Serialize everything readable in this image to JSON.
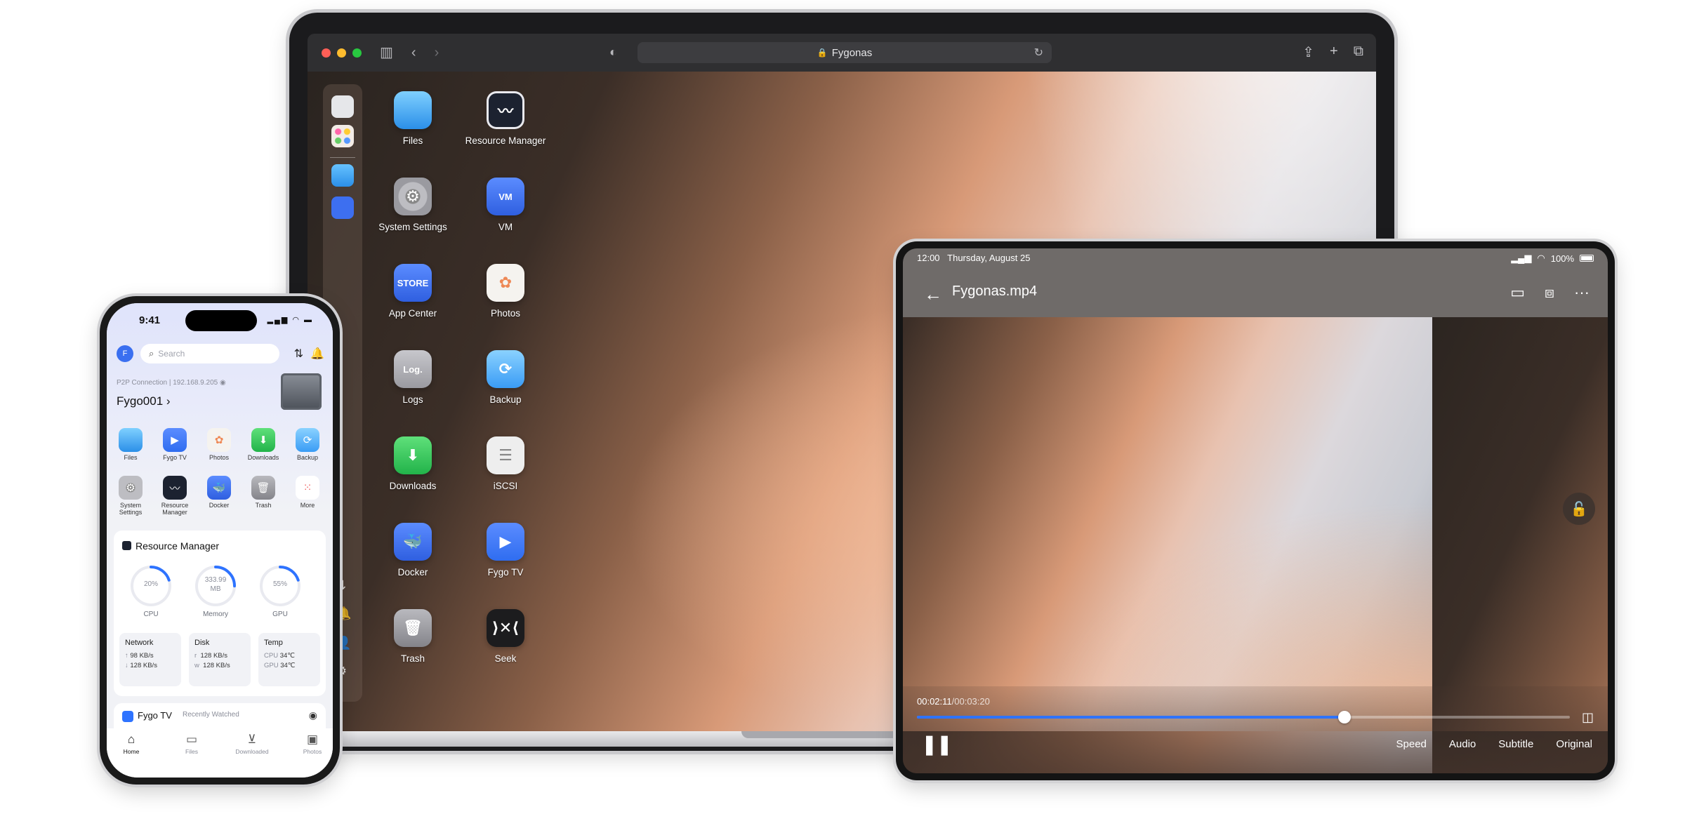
{
  "colors": {
    "accent": "#2e73ff",
    "files_blue": "#3aa7f3",
    "green": "#34c759",
    "docker_blue": "#3d6ff0"
  },
  "laptop": {
    "browser": {
      "address": "Fygonas"
    },
    "apps": [
      {
        "label": "Files",
        "icon": "folder-icon"
      },
      {
        "label": "Resource Manager",
        "icon": "pulse-icon"
      },
      {
        "label": "System Settings",
        "icon": "gear-icon"
      },
      {
        "label": "VM",
        "icon": "vm-icon",
        "badge": "VM"
      },
      {
        "label": "App Center",
        "icon": "store-icon",
        "badge": "STORE"
      },
      {
        "label": "Photos",
        "icon": "flower-icon"
      },
      {
        "label": "Logs",
        "icon": "logs-icon",
        "badge": "Log."
      },
      {
        "label": "Backup",
        "icon": "sync-icon"
      },
      {
        "label": "Downloads",
        "icon": "download-icon"
      },
      {
        "label": "iSCSI",
        "icon": "disk-icon"
      },
      {
        "label": "Docker",
        "icon": "whale-icon"
      },
      {
        "label": "Fygo TV",
        "icon": "tv-icon"
      },
      {
        "label": "Trash",
        "icon": "trash-icon"
      },
      {
        "label": "Seek",
        "icon": "seek-icon"
      }
    ]
  },
  "tablet": {
    "status": {
      "time": "12:00",
      "date": "Thursday, August 25",
      "battery": "100%"
    },
    "title": "Fygonas.mp4",
    "player": {
      "current": "00:02:11",
      "total": "/00:03:20",
      "progress": 0.655,
      "options": [
        "Speed",
        "Audio",
        "Subtitle",
        "Original"
      ]
    }
  },
  "phone": {
    "status": {
      "time": "9:41"
    },
    "avatar": "F",
    "search_placeholder": "Search",
    "connection": "P2P Connection | 192.168.9.205",
    "device": "Fygo001",
    "apps": [
      {
        "label": "Files"
      },
      {
        "label": "Fygo TV"
      },
      {
        "label": "Photos"
      },
      {
        "label": "Downloads"
      },
      {
        "label": "Backup"
      },
      {
        "label": "System Settings"
      },
      {
        "label": "Resource Manager"
      },
      {
        "label": "Docker"
      },
      {
        "label": "Trash"
      },
      {
        "label": "More"
      }
    ],
    "resource": {
      "title": "Resource Manager",
      "gauges": [
        {
          "label": "CPU",
          "value": "20%",
          "fraction": 0.2
        },
        {
          "label": "Memory",
          "value": "333.99 MB",
          "fraction": 0.25
        },
        {
          "label": "GPU",
          "value": "55%",
          "fraction": 0.2
        }
      ],
      "network": {
        "title": "Network",
        "up": "98 KB/s",
        "down": "128 KB/s"
      },
      "disk": {
        "title": "Disk",
        "r_label": "r",
        "r": "128 KB/s",
        "w_label": "w",
        "w": "128 KB/s"
      },
      "temp": {
        "title": "Temp",
        "cpu_label": "CPU",
        "cpu": "34℃",
        "gpu_label": "GPU",
        "gpu": "34℃"
      }
    },
    "tv": {
      "title": "Fygo TV",
      "subtitle": "Recently Watched"
    },
    "tabs": [
      "Home",
      "Files",
      "Downloaded",
      "Photos"
    ]
  }
}
